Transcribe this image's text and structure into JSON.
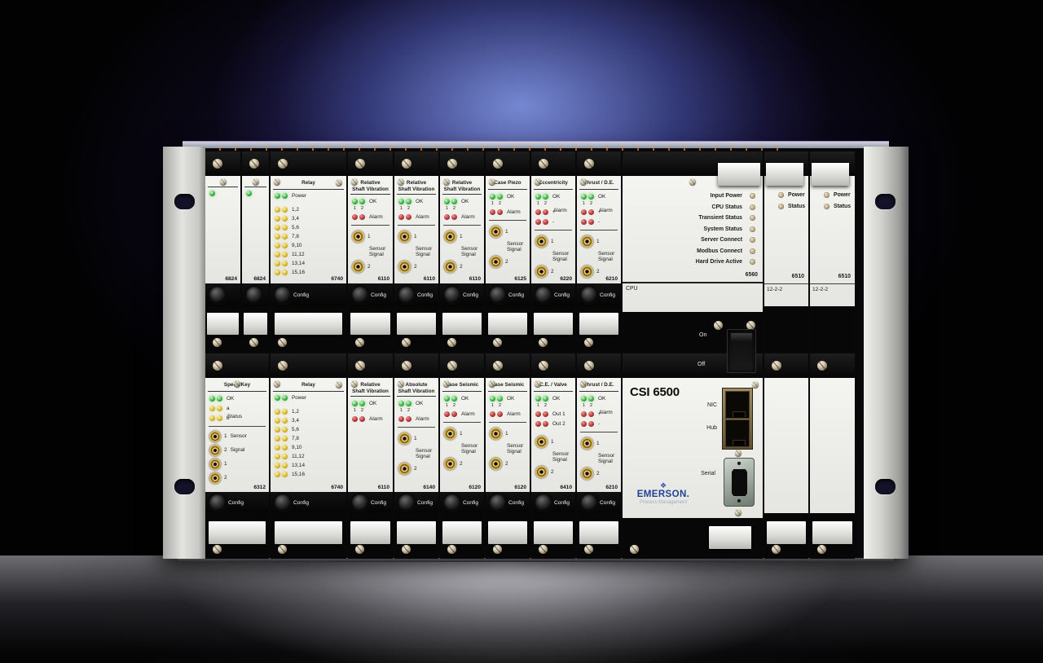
{
  "colors": {
    "glow_blue": "#41519e",
    "led_green": "#43b049",
    "led_yellow": "#d9bb2e",
    "led_red": "#b5383b",
    "status_amber": "#c7b58e",
    "emerson_blue": "#1f4096",
    "bnc_gold": "#c9a23f"
  },
  "power_switch": {
    "on": "On",
    "off": "Off"
  },
  "rack": {
    "top": [
      {
        "kind": "narrow",
        "model": "6824",
        "title_lines": [],
        "blocks": [
          {
            "t": "leds",
            "c": [
              "green"
            ],
            "label": ""
          }
        ],
        "config_label": ""
      },
      {
        "kind": "narrow",
        "model": "6824",
        "title_lines": [],
        "blocks": [
          {
            "t": "leds",
            "c": [
              "green"
            ],
            "label": ""
          }
        ],
        "config_label": ""
      },
      {
        "kind": "wide",
        "model": "6740",
        "title_lines": [
          "Relay"
        ],
        "blocks": [
          {
            "t": "leds",
            "c": [
              "green",
              "green"
            ],
            "label": "Power"
          },
          {
            "t": "gap"
          },
          {
            "t": "leds",
            "c": [
              "yellow",
              "yellow"
            ],
            "label": "1,2"
          },
          {
            "t": "leds",
            "c": [
              "yellow",
              "yellow"
            ],
            "label": "3,4"
          },
          {
            "t": "leds",
            "c": [
              "yellow",
              "yellow"
            ],
            "label": "5,6"
          },
          {
            "t": "leds",
            "c": [
              "yellow",
              "yellow"
            ],
            "label": "7,8"
          },
          {
            "t": "leds",
            "c": [
              "yellow",
              "yellow"
            ],
            "label": "9,10"
          },
          {
            "t": "leds",
            "c": [
              "yellow",
              "yellow"
            ],
            "label": "11,12"
          },
          {
            "t": "leds",
            "c": [
              "yellow",
              "yellow"
            ],
            "label": "13,14"
          },
          {
            "t": "leds",
            "c": [
              "yellow",
              "yellow"
            ],
            "label": "15,16"
          }
        ],
        "config_label": "Config"
      },
      {
        "kind": "std",
        "model": "6110",
        "title_lines": [
          "Relative",
          "Shaft Vibration"
        ],
        "blocks": [
          {
            "t": "leds",
            "c": [
              "green",
              "green"
            ],
            "label": "OK"
          },
          {
            "t": "sub",
            "a": "1",
            "b": "2"
          },
          {
            "t": "leds",
            "c": [
              "red",
              "red"
            ],
            "label": "Alarm"
          },
          {
            "t": "rule"
          },
          {
            "t": "bnc",
            "label": "1"
          },
          {
            "t": "txt",
            "lines": [
              "Sensor",
              "Signal"
            ]
          },
          {
            "t": "bnc",
            "label": "2"
          }
        ],
        "config_label": "Config"
      },
      {
        "kind": "std",
        "model": "6110",
        "title_lines": [
          "Relative",
          "Shaft Vibration"
        ],
        "blocks": [
          {
            "t": "leds",
            "c": [
              "green",
              "green"
            ],
            "label": "OK"
          },
          {
            "t": "sub",
            "a": "1",
            "b": "2"
          },
          {
            "t": "leds",
            "c": [
              "red",
              "red"
            ],
            "label": "Alarm"
          },
          {
            "t": "rule"
          },
          {
            "t": "bnc",
            "label": "1"
          },
          {
            "t": "txt",
            "lines": [
              "Sensor",
              "Signal"
            ]
          },
          {
            "t": "bnc",
            "label": "2"
          }
        ],
        "config_label": "Config"
      },
      {
        "kind": "std",
        "model": "6110",
        "title_lines": [
          "Relative",
          "Shaft Vibration"
        ],
        "blocks": [
          {
            "t": "leds",
            "c": [
              "green",
              "green"
            ],
            "label": "OK"
          },
          {
            "t": "sub",
            "a": "1",
            "b": "2"
          },
          {
            "t": "leds",
            "c": [
              "red",
              "red"
            ],
            "label": "Alarm"
          },
          {
            "t": "rule"
          },
          {
            "t": "bnc",
            "label": "1"
          },
          {
            "t": "txt",
            "lines": [
              "Sensor",
              "Signal"
            ]
          },
          {
            "t": "bnc",
            "label": "2"
          }
        ],
        "config_label": "Config"
      },
      {
        "kind": "std",
        "model": "6125",
        "title_lines": [
          "Case Piezo"
        ],
        "blocks": [
          {
            "t": "leds",
            "c": [
              "green",
              "green"
            ],
            "label": "OK"
          },
          {
            "t": "sub",
            "a": "1",
            "b": "2"
          },
          {
            "t": "leds",
            "c": [
              "red",
              "red"
            ],
            "label": "Alarm"
          },
          {
            "t": "rule"
          },
          {
            "t": "bnc",
            "label": "1"
          },
          {
            "t": "txt",
            "lines": [
              "Sensor",
              "Signal"
            ]
          },
          {
            "t": "bnc",
            "label": "2"
          }
        ],
        "config_label": "Config"
      },
      {
        "kind": "std",
        "model": "6220",
        "title_lines": [
          "Eccentricity"
        ],
        "blocks": [
          {
            "t": "leds",
            "c": [
              "green",
              "green"
            ],
            "label": "OK"
          },
          {
            "t": "sub",
            "a": "1",
            "b": "2"
          },
          {
            "t": "leds",
            "c": [
              "red",
              "red"
            ],
            "label": "+",
            "side": "Alarm"
          },
          {
            "t": "leds",
            "c": [
              "red",
              "red"
            ],
            "label": "-"
          },
          {
            "t": "rule"
          },
          {
            "t": "bnc",
            "label": "1"
          },
          {
            "t": "txt",
            "lines": [
              "Sensor",
              "Signal"
            ]
          },
          {
            "t": "bnc",
            "label": "2"
          }
        ],
        "config_label": "Config"
      },
      {
        "kind": "std",
        "model": "6210",
        "title_lines": [
          "Thrust / D.E."
        ],
        "blocks": [
          {
            "t": "leds",
            "c": [
              "green",
              "green"
            ],
            "label": "OK"
          },
          {
            "t": "sub",
            "a": "1",
            "b": "2"
          },
          {
            "t": "leds",
            "c": [
              "red",
              "red"
            ],
            "label": "+",
            "side": "Alarm"
          },
          {
            "t": "leds",
            "c": [
              "red",
              "red"
            ],
            "label": "-"
          },
          {
            "t": "rule"
          },
          {
            "t": "bnc",
            "label": "1"
          },
          {
            "t": "txt",
            "lines": [
              "Sensor",
              "Signal"
            ]
          },
          {
            "t": "bnc",
            "label": "2"
          }
        ],
        "config_label": "Config"
      },
      {
        "kind": "cpu",
        "model": "6560",
        "footer": "CPU",
        "status_labels": [
          "Input Power",
          "CPU Status",
          "Transient Status",
          "System Status",
          "Server Connect",
          "Modbus Connect",
          "Hard Drive Active"
        ]
      },
      {
        "kind": "io",
        "model": "6510",
        "footer": "12-2-2",
        "led_labels": [
          "Power",
          "Status"
        ]
      },
      {
        "kind": "io",
        "model": "6510",
        "footer": "12-2-2",
        "led_labels": [
          "Power",
          "Status"
        ]
      }
    ],
    "bottom": [
      {
        "kind": "speedkey",
        "model": "6312",
        "title_lines": [
          "Speed/Key"
        ],
        "blocks": [
          {
            "t": "leds",
            "c": [
              "green",
              "green"
            ],
            "label": "OK"
          },
          {
            "t": "leds",
            "c": [
              "yellow",
              "yellow"
            ],
            "label": "a"
          },
          {
            "t": "leds",
            "c": [
              "yellow",
              "yellow"
            ],
            "label": "b",
            "side": "Status"
          },
          {
            "t": "rule"
          },
          {
            "t": "bnc",
            "label": "1",
            "label2": "Sensor"
          },
          {
            "t": "bnc",
            "label": "2",
            "label2": "Signal"
          },
          {
            "t": "bnc",
            "label": "1"
          },
          {
            "t": "bnc",
            "label": "2"
          }
        ],
        "config_label": "Config"
      },
      {
        "kind": "wide",
        "model": "6740",
        "title_lines": [
          "Relay"
        ],
        "blocks": [
          {
            "t": "leds",
            "c": [
              "green",
              "green"
            ],
            "label": "Power"
          },
          {
            "t": "gap"
          },
          {
            "t": "leds",
            "c": [
              "yellow",
              "yellow"
            ],
            "label": "1,2"
          },
          {
            "t": "leds",
            "c": [
              "yellow",
              "yellow"
            ],
            "label": "3,4"
          },
          {
            "t": "leds",
            "c": [
              "yellow",
              "yellow"
            ],
            "label": "5,6"
          },
          {
            "t": "leds",
            "c": [
              "yellow",
              "yellow"
            ],
            "label": "7,8"
          },
          {
            "t": "leds",
            "c": [
              "yellow",
              "yellow"
            ],
            "label": "9,10"
          },
          {
            "t": "leds",
            "c": [
              "yellow",
              "yellow"
            ],
            "label": "11,12"
          },
          {
            "t": "leds",
            "c": [
              "yellow",
              "yellow"
            ],
            "label": "13,14"
          },
          {
            "t": "leds",
            "c": [
              "yellow",
              "yellow"
            ],
            "label": "15,16"
          }
        ],
        "config_label": "Config"
      },
      {
        "kind": "std",
        "model": "6110",
        "title_lines": [
          "Relative",
          "Shaft Vibration"
        ],
        "blocks": [
          {
            "t": "leds",
            "c": [
              "green",
              "green"
            ],
            "label": "OK"
          },
          {
            "t": "sub",
            "a": "1",
            "b": "2"
          },
          {
            "t": "leds",
            "c": [
              "red",
              "red"
            ],
            "label": "Alarm"
          }
        ],
        "config_label": "Config"
      },
      {
        "kind": "std",
        "model": "6140",
        "title_lines": [
          "Absolute",
          "Shaft Vibration"
        ],
        "blocks": [
          {
            "t": "leds",
            "c": [
              "green",
              "green"
            ],
            "label": "OK"
          },
          {
            "t": "sub",
            "a": "1",
            "b": "2"
          },
          {
            "t": "leds",
            "c": [
              "red",
              "red"
            ],
            "label": "Alarm"
          },
          {
            "t": "rule"
          },
          {
            "t": "bnc",
            "label": "1"
          },
          {
            "t": "txt",
            "lines": [
              "Sensor",
              "Signal"
            ]
          },
          {
            "t": "bnc",
            "label": "2"
          }
        ],
        "config_label": "Config"
      },
      {
        "kind": "std",
        "model": "6120",
        "title_lines": [
          "Case Seismic"
        ],
        "blocks": [
          {
            "t": "leds",
            "c": [
              "green",
              "green"
            ],
            "label": "OK"
          },
          {
            "t": "sub",
            "a": "1",
            "b": "2"
          },
          {
            "t": "leds",
            "c": [
              "red",
              "red"
            ],
            "label": "Alarm"
          },
          {
            "t": "rule"
          },
          {
            "t": "bnc",
            "label": "1"
          },
          {
            "t": "txt",
            "lines": [
              "Sensor",
              "Signal"
            ]
          },
          {
            "t": "bnc",
            "label": "2"
          }
        ],
        "config_label": "Config"
      },
      {
        "kind": "std",
        "model": "6120",
        "title_lines": [
          "Case Seismic"
        ],
        "blocks": [
          {
            "t": "leds",
            "c": [
              "green",
              "green"
            ],
            "label": "OK"
          },
          {
            "t": "sub",
            "a": "1",
            "b": "2"
          },
          {
            "t": "leds",
            "c": [
              "red",
              "red"
            ],
            "label": "Alarm"
          },
          {
            "t": "rule"
          },
          {
            "t": "bnc",
            "label": "1"
          },
          {
            "t": "txt",
            "lines": [
              "Sensor",
              "Signal"
            ]
          },
          {
            "t": "bnc",
            "label": "2"
          }
        ],
        "config_label": "Config"
      },
      {
        "kind": "std",
        "model": "6410",
        "title_lines": [
          "C.E. / Valve"
        ],
        "blocks": [
          {
            "t": "leds",
            "c": [
              "green",
              "green"
            ],
            "label": "OK"
          },
          {
            "t": "sub",
            "a": "1",
            "b": "2"
          },
          {
            "t": "leds",
            "c": [
              "red",
              "red"
            ],
            "label": "Out 1"
          },
          {
            "t": "leds",
            "c": [
              "red",
              "red"
            ],
            "label": "Out 2"
          },
          {
            "t": "gap"
          },
          {
            "t": "bnc",
            "label": "1"
          },
          {
            "t": "txt",
            "lines": [
              "Sensor",
              "Signal"
            ]
          },
          {
            "t": "bnc",
            "label": "2"
          }
        ],
        "config_label": "Config"
      },
      {
        "kind": "std",
        "model": "6210",
        "title_lines": [
          "Thrust / D.E."
        ],
        "blocks": [
          {
            "t": "leds",
            "c": [
              "green",
              "green"
            ],
            "label": "OK"
          },
          {
            "t": "sub",
            "a": "1",
            "b": "2"
          },
          {
            "t": "leds",
            "c": [
              "red",
              "red"
            ],
            "label": "+",
            "side": "Alarm"
          },
          {
            "t": "leds",
            "c": [
              "red",
              "red"
            ],
            "label": "-"
          },
          {
            "t": "rule"
          },
          {
            "t": "bnc",
            "label": "1"
          },
          {
            "t": "txt",
            "lines": [
              "Sensor",
              "Signal"
            ]
          },
          {
            "t": "bnc",
            "label": "2"
          }
        ],
        "config_label": "Config"
      },
      {
        "kind": "main",
        "title": "CSI 6500",
        "port_labels": {
          "nic": "NIC",
          "hub": "Hub",
          "serial": "Serial"
        },
        "brand": {
          "name": "EMERSON.",
          "subtitle": "Process Management"
        }
      },
      {
        "kind": "blank"
      },
      {
        "kind": "blank"
      }
    ]
  }
}
